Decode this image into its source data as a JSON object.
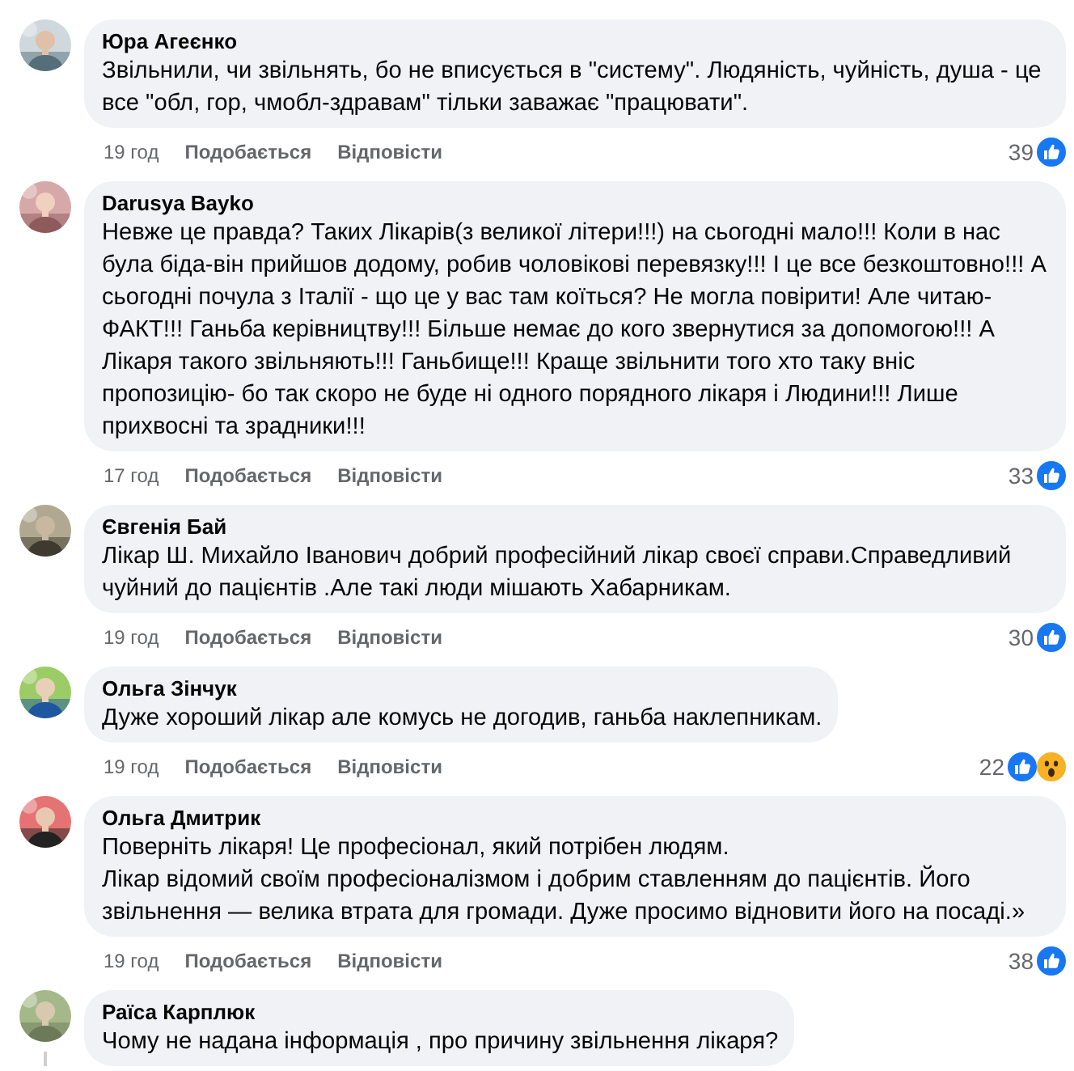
{
  "comments": [
    {
      "author": "Юра Агеєнко",
      "text": "Звільнили, чи звільнять, бо не вписується в \"систему\". Людяність, чуйність, душа - це все \"обл, гор, чмобл-здравам\" тільки заважає \"працювати\".",
      "time": "19 год",
      "like_label": "Подобається",
      "reply_label": "Відповісти",
      "reaction_count": "39",
      "reactions": [
        {
          "kind": "like"
        }
      ]
    },
    {
      "author": "Darusya Bayko",
      "text": "Невже це правда? Таких Лікарів(з великої літери!!!) на сьогодні мало!!! Коли в нас була біда-він прийшов додому, робив чоловікові перевязку!!! І це все безкоштовно!!! А сьогодні почула з Італії - що це у вас там коїться? Не могла повірити! Але читаю-ФАКТ!!! Ганьба керівництву!!! Більше немає до кого звернутися за допомогою!!! А Лікаря такого звільняють!!! Ганьбище!!! Краще звільнити того хто таку вніс пропозицію- бо так скоро не буде ні одного порядного лікаря і Людини!!! Лише прихвосні та зрадники!!!",
      "time": "17 год",
      "like_label": "Подобається",
      "reply_label": "Відповісти",
      "reaction_count": "33",
      "reactions": [
        {
          "kind": "like"
        }
      ]
    },
    {
      "author": "Євгенія Бай",
      "text": "Лікар Ш. Михайло Іванович добрий професійний лікар своєї справи.Справедливий чуйний до пацієнтів .Але такі люди мішають Хабарникам.",
      "time": "19 год",
      "like_label": "Подобається",
      "reply_label": "Відповісти",
      "reaction_count": "30",
      "reactions": [
        {
          "kind": "like"
        }
      ]
    },
    {
      "author": "Ольга Зінчук",
      "text": "Дуже хороший лікар але комусь не догодив, ганьба наклепникам.",
      "time": "19 год",
      "like_label": "Подобається",
      "reply_label": "Відповісти",
      "reaction_count": "22",
      "reactions": [
        {
          "kind": "like"
        },
        {
          "kind": "wow"
        }
      ]
    },
    {
      "author": "Ольга Дмитрик",
      "text": "Поверніть лікаря! Це професіонал, який потрібен людям.\nЛікар відомий своїм професіоналізмом і добрим ставленням до пацієнтів. Його звільнення — велика втрата для громади. Дуже просимо відновити його на посаді.»",
      "time": "19 год",
      "like_label": "Подобається",
      "reply_label": "Відповісти",
      "reaction_count": "38",
      "reactions": [
        {
          "kind": "like"
        }
      ]
    },
    {
      "author": "Раїса Карплюк",
      "text": "Чому не надана інформація , про причину звільнення лікаря?",
      "has_replies": true
    }
  ]
}
